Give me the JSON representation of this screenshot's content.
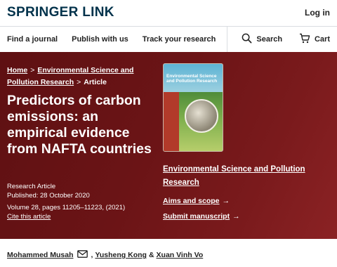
{
  "header": {
    "logo": "SPRINGER LINK",
    "login": "Log in"
  },
  "nav": {
    "find_journal": "Find a journal",
    "publish": "Publish with us",
    "track": "Track your research",
    "search": "Search",
    "cart": "Cart"
  },
  "breadcrumb": {
    "home": "Home",
    "journal": "Environmental Science and Pollution Research",
    "article": "Article",
    "separator": ">"
  },
  "article": {
    "title": "Predictors of carbon emissions: an empirical evidence from NAFTA countries",
    "type": "Research Article",
    "published": "Published: 28 October 2020",
    "volume": "Volume 28, pages 11205–11223, (2021)",
    "cite": "Cite this article"
  },
  "cover": {
    "title": "Environmental Science and Pollution Research"
  },
  "sidebar": {
    "journal_name": "Environmental Science and Pollution Research",
    "aims": "Aims and scope",
    "submit": "Submit manuscript",
    "arrow": "→"
  },
  "authors": {
    "author1": "Mohammed Musah",
    "sep1": ",",
    "author2": "Yusheng Kong",
    "amp": "&",
    "author3": "Xuan Vinh Vo"
  }
}
